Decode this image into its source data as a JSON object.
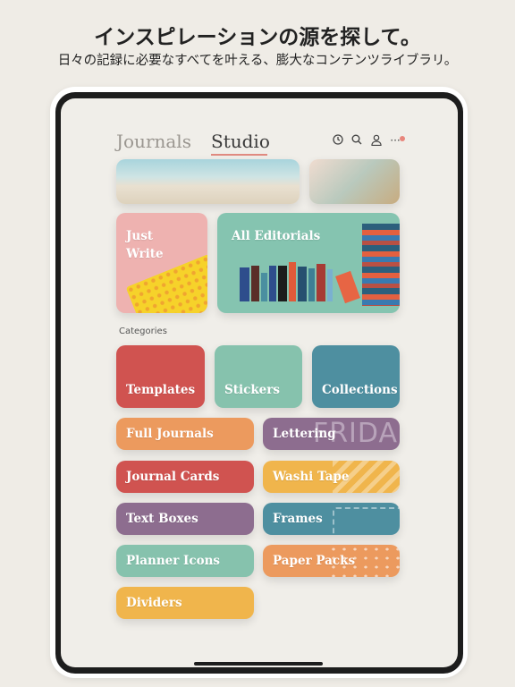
{
  "promo": {
    "title": "インスピレーションの源を探して。",
    "subtitle": "日々の記録に必要なすべてを叶える、膨大なコンテンツライブラリ。"
  },
  "header": {
    "tabs": [
      {
        "label": "Journals",
        "active": false
      },
      {
        "label": "Studio",
        "active": true
      }
    ],
    "icons": [
      "clock-icon",
      "search-icon",
      "profile-icon",
      "more-icon"
    ],
    "notification_dot_color": "#e8867c"
  },
  "featured": {
    "just_write": "Just Write",
    "just_write_line1": "Just",
    "just_write_line2": "Write",
    "all_editorials": "All Editorials"
  },
  "categories_label": "Categories",
  "categories": [
    {
      "label": "Templates",
      "color": "#d05350"
    },
    {
      "label": "Stickers",
      "color": "#86c2ad"
    },
    {
      "label": "Collections",
      "color": "#4e8fa0"
    },
    {
      "label": "Full Journals",
      "color": "#ec9a5e"
    },
    {
      "label": "Lettering",
      "color": "#8d6d8f"
    },
    {
      "label": "Journal Cards",
      "color": "#d05350"
    },
    {
      "label": "Washi Tape",
      "color": "#f0b54c"
    },
    {
      "label": "Text Boxes",
      "color": "#8d6d8f"
    },
    {
      "label": "Frames",
      "color": "#4e8fa0"
    },
    {
      "label": "Planner Icons",
      "color": "#86c2ad"
    },
    {
      "label": "Paper Packs",
      "color": "#ec9a5e"
    },
    {
      "label": "Dividers",
      "color": "#f0b54c"
    }
  ],
  "lettering_deco": "FRIDA"
}
